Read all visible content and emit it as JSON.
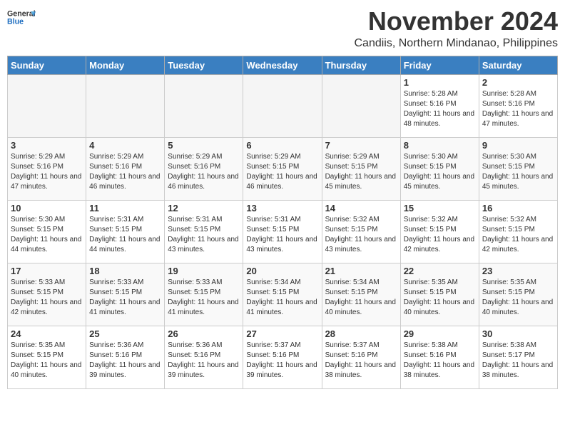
{
  "header": {
    "logo_line1": "General",
    "logo_line2": "Blue",
    "month": "November 2024",
    "location": "Candiis, Northern Mindanao, Philippines"
  },
  "weekdays": [
    "Sunday",
    "Monday",
    "Tuesday",
    "Wednesday",
    "Thursday",
    "Friday",
    "Saturday"
  ],
  "weeks": [
    [
      {
        "day": "",
        "empty": true
      },
      {
        "day": "",
        "empty": true
      },
      {
        "day": "",
        "empty": true
      },
      {
        "day": "",
        "empty": true
      },
      {
        "day": "",
        "empty": true
      },
      {
        "day": "1",
        "sunrise": "5:28 AM",
        "sunset": "5:16 PM",
        "daylight": "11 hours and 48 minutes."
      },
      {
        "day": "2",
        "sunrise": "5:28 AM",
        "sunset": "5:16 PM",
        "daylight": "11 hours and 47 minutes."
      }
    ],
    [
      {
        "day": "3",
        "sunrise": "5:29 AM",
        "sunset": "5:16 PM",
        "daylight": "11 hours and 47 minutes."
      },
      {
        "day": "4",
        "sunrise": "5:29 AM",
        "sunset": "5:16 PM",
        "daylight": "11 hours and 46 minutes."
      },
      {
        "day": "5",
        "sunrise": "5:29 AM",
        "sunset": "5:16 PM",
        "daylight": "11 hours and 46 minutes."
      },
      {
        "day": "6",
        "sunrise": "5:29 AM",
        "sunset": "5:15 PM",
        "daylight": "11 hours and 46 minutes."
      },
      {
        "day": "7",
        "sunrise": "5:29 AM",
        "sunset": "5:15 PM",
        "daylight": "11 hours and 45 minutes."
      },
      {
        "day": "8",
        "sunrise": "5:30 AM",
        "sunset": "5:15 PM",
        "daylight": "11 hours and 45 minutes."
      },
      {
        "day": "9",
        "sunrise": "5:30 AM",
        "sunset": "5:15 PM",
        "daylight": "11 hours and 45 minutes."
      }
    ],
    [
      {
        "day": "10",
        "sunrise": "5:30 AM",
        "sunset": "5:15 PM",
        "daylight": "11 hours and 44 minutes."
      },
      {
        "day": "11",
        "sunrise": "5:31 AM",
        "sunset": "5:15 PM",
        "daylight": "11 hours and 44 minutes."
      },
      {
        "day": "12",
        "sunrise": "5:31 AM",
        "sunset": "5:15 PM",
        "daylight": "11 hours and 43 minutes."
      },
      {
        "day": "13",
        "sunrise": "5:31 AM",
        "sunset": "5:15 PM",
        "daylight": "11 hours and 43 minutes."
      },
      {
        "day": "14",
        "sunrise": "5:32 AM",
        "sunset": "5:15 PM",
        "daylight": "11 hours and 43 minutes."
      },
      {
        "day": "15",
        "sunrise": "5:32 AM",
        "sunset": "5:15 PM",
        "daylight": "11 hours and 42 minutes."
      },
      {
        "day": "16",
        "sunrise": "5:32 AM",
        "sunset": "5:15 PM",
        "daylight": "11 hours and 42 minutes."
      }
    ],
    [
      {
        "day": "17",
        "sunrise": "5:33 AM",
        "sunset": "5:15 PM",
        "daylight": "11 hours and 42 minutes."
      },
      {
        "day": "18",
        "sunrise": "5:33 AM",
        "sunset": "5:15 PM",
        "daylight": "11 hours and 41 minutes."
      },
      {
        "day": "19",
        "sunrise": "5:33 AM",
        "sunset": "5:15 PM",
        "daylight": "11 hours and 41 minutes."
      },
      {
        "day": "20",
        "sunrise": "5:34 AM",
        "sunset": "5:15 PM",
        "daylight": "11 hours and 41 minutes."
      },
      {
        "day": "21",
        "sunrise": "5:34 AM",
        "sunset": "5:15 PM",
        "daylight": "11 hours and 40 minutes."
      },
      {
        "day": "22",
        "sunrise": "5:35 AM",
        "sunset": "5:15 PM",
        "daylight": "11 hours and 40 minutes."
      },
      {
        "day": "23",
        "sunrise": "5:35 AM",
        "sunset": "5:15 PM",
        "daylight": "11 hours and 40 minutes."
      }
    ],
    [
      {
        "day": "24",
        "sunrise": "5:35 AM",
        "sunset": "5:15 PM",
        "daylight": "11 hours and 40 minutes."
      },
      {
        "day": "25",
        "sunrise": "5:36 AM",
        "sunset": "5:16 PM",
        "daylight": "11 hours and 39 minutes."
      },
      {
        "day": "26",
        "sunrise": "5:36 AM",
        "sunset": "5:16 PM",
        "daylight": "11 hours and 39 minutes."
      },
      {
        "day": "27",
        "sunrise": "5:37 AM",
        "sunset": "5:16 PM",
        "daylight": "11 hours and 39 minutes."
      },
      {
        "day": "28",
        "sunrise": "5:37 AM",
        "sunset": "5:16 PM",
        "daylight": "11 hours and 38 minutes."
      },
      {
        "day": "29",
        "sunrise": "5:38 AM",
        "sunset": "5:16 PM",
        "daylight": "11 hours and 38 minutes."
      },
      {
        "day": "30",
        "sunrise": "5:38 AM",
        "sunset": "5:17 PM",
        "daylight": "11 hours and 38 minutes."
      }
    ]
  ]
}
